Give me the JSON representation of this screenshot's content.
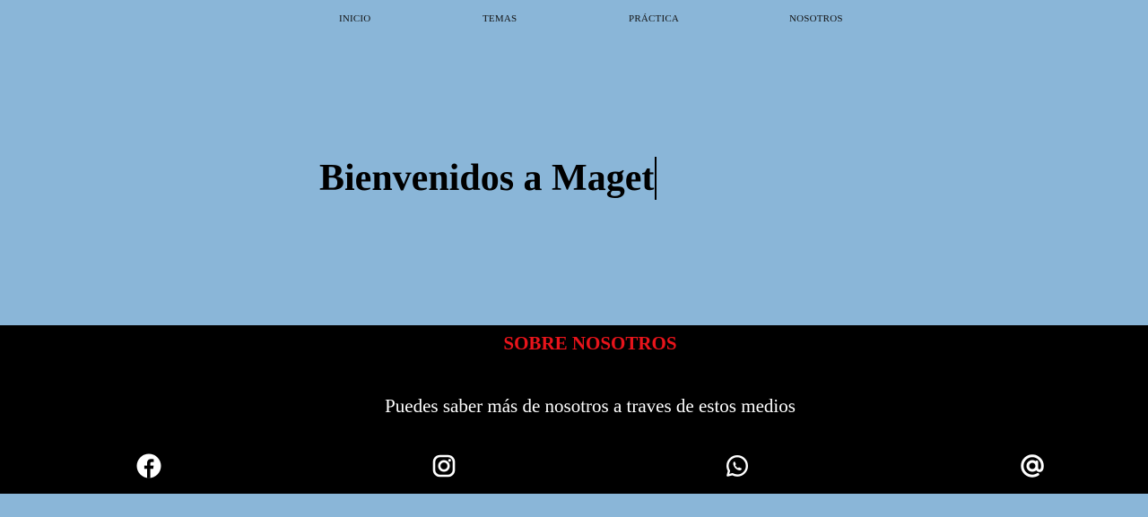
{
  "nav": {
    "items": [
      {
        "label": "INICIO"
      },
      {
        "label": "TEMAS"
      },
      {
        "label": "PRÁCTICA"
      },
      {
        "label": "NOSOTROS"
      }
    ]
  },
  "hero": {
    "title": "Bienvenidos a Maget"
  },
  "footer": {
    "title": "SOBRE NOSOTROS",
    "text": "Puedes saber más de nosotros a traves de estos medios",
    "social": [
      {
        "icon": "facebook-icon"
      },
      {
        "icon": "instagram-icon"
      },
      {
        "icon": "whatsapp-icon"
      },
      {
        "icon": "at-sign-icon"
      }
    ],
    "colors": {
      "background": "#000000",
      "title": "#e8141b",
      "text": "#ffffff"
    }
  },
  "colors": {
    "page_background": "#8ab6d8"
  }
}
